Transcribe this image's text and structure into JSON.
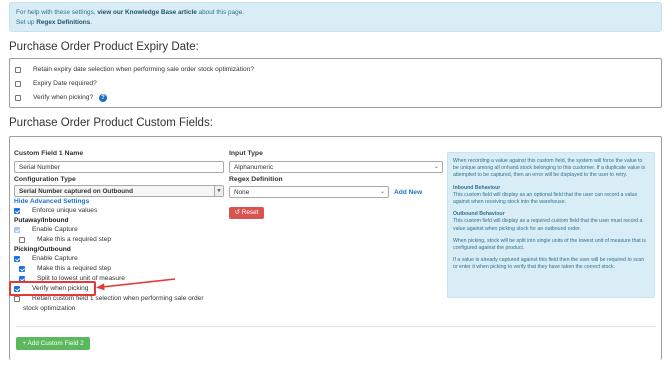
{
  "info_banner": {
    "line1_pre": "For help with these settings, ",
    "line1_link": "view our Knowledge Base article",
    "line1_post": " about this page.",
    "line2_pre": "Set up ",
    "line2_link": "Regex Definitions",
    "line2_post": "."
  },
  "expiry_section": {
    "title": "Purchase Order Product Expiry Date:",
    "options": [
      {
        "label": "Retain expiry date selection when performing sale order stock optimization?",
        "checked": false
      },
      {
        "label": "Expiry Date required?",
        "checked": false
      },
      {
        "label": "Verify when picking?",
        "checked": false
      }
    ],
    "help_symbol": "?"
  },
  "custom_section": {
    "title": "Purchase Order Product Custom Fields:",
    "field1": {
      "label": "Custom Field 1 Name",
      "value": "Serial Number",
      "config_label": "Configuration Type",
      "config_value": "Serial Number captured on Outbound",
      "hide_advanced": "Hide Advanced Settings",
      "enforce_unique": "Enforce unique values",
      "putaway_heading": "Putaway/Inbound",
      "enable_capture_in": "Enable Capture",
      "make_required_in": "Make this a required step",
      "picking_heading": "Picking/Outbound",
      "enable_capture_out": "Enable Capture",
      "make_required_out": "Make this a required step",
      "split_units": "Split to lowest unit of measure",
      "verify_picking": "Verify when picking",
      "retain_line1": "Retain custom field 1 selection when performing sale order",
      "retain_line2": "stock optimization"
    },
    "input_type": {
      "label": "Input Type",
      "value": "Alphanumeric"
    },
    "regex": {
      "label": "Regex Definition",
      "value": "None",
      "add_new": "Add New"
    },
    "reset_button": "Reset",
    "reset_icon": "undo-icon",
    "add_field_button": "+ Add Custom Field 2"
  },
  "side_info": {
    "p1": "When recording a value against this custom field, the system will force the value to be unique among all onhand stock belonging to this customer. If a duplicate value is attempted to be captured, then an error will be displayed to the user to retry.",
    "inbound_head": "Inbound Behaviour",
    "inbound_text": "This custom field will display as an optional field that the user can record a value against when receiving stock into the warehouse.",
    "outbound_head": "Outbound Behaviour",
    "outbound_text": "This custom field will display as a required custom field that the user must record a value against when picking stock for an outbound order.",
    "p_picking": "When picking, stock will be split into single units of the lowest unit of measure that is configured against the product.",
    "p_captured": "If a value is already captured against this field then the user will be required to scan or enter it when picking to verify that they have taken the correct stock."
  },
  "colors": {
    "banner_bg": "#d9edf7",
    "link_blue": "#1a73c8",
    "reset_red": "#d9534f",
    "add_green": "#5cb85c",
    "annotation_red": "#e53935"
  }
}
